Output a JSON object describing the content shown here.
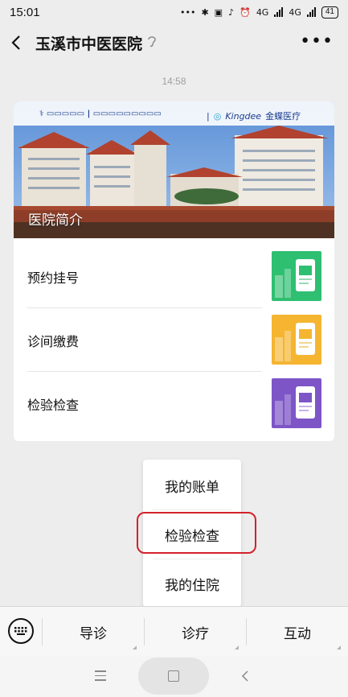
{
  "status_bar": {
    "time": "15:01",
    "network_1": "4G",
    "network_2": "4G",
    "battery": "41"
  },
  "nav": {
    "title": "玉溪市中医医院"
  },
  "chat": {
    "timestamp": "14:58"
  },
  "article_card": {
    "cover_title": "医院简介",
    "cover_logo_brand": "Kingdee",
    "cover_logo_brand_cn": "金蝶医疗",
    "items": [
      {
        "label": "预约挂号",
        "thumb_color": "#2fbf71"
      },
      {
        "label": "诊间缴费",
        "thumb_color": "#f5b531"
      },
      {
        "label": "检验检查",
        "thumb_color": "#7d55c7"
      }
    ]
  },
  "popup_menu": {
    "items": [
      "我的账单",
      "检验检查",
      "我的住院"
    ],
    "highlighted": "检验检查",
    "highlight_color": "#d3222a"
  },
  "bottom_menu": {
    "items": [
      "导诊",
      "诊疗",
      "互动"
    ]
  },
  "icons": {
    "back": "back-arrow-icon",
    "ear": "ear-icon",
    "more": "more-icon",
    "keyboard": "keyboard-icon"
  }
}
